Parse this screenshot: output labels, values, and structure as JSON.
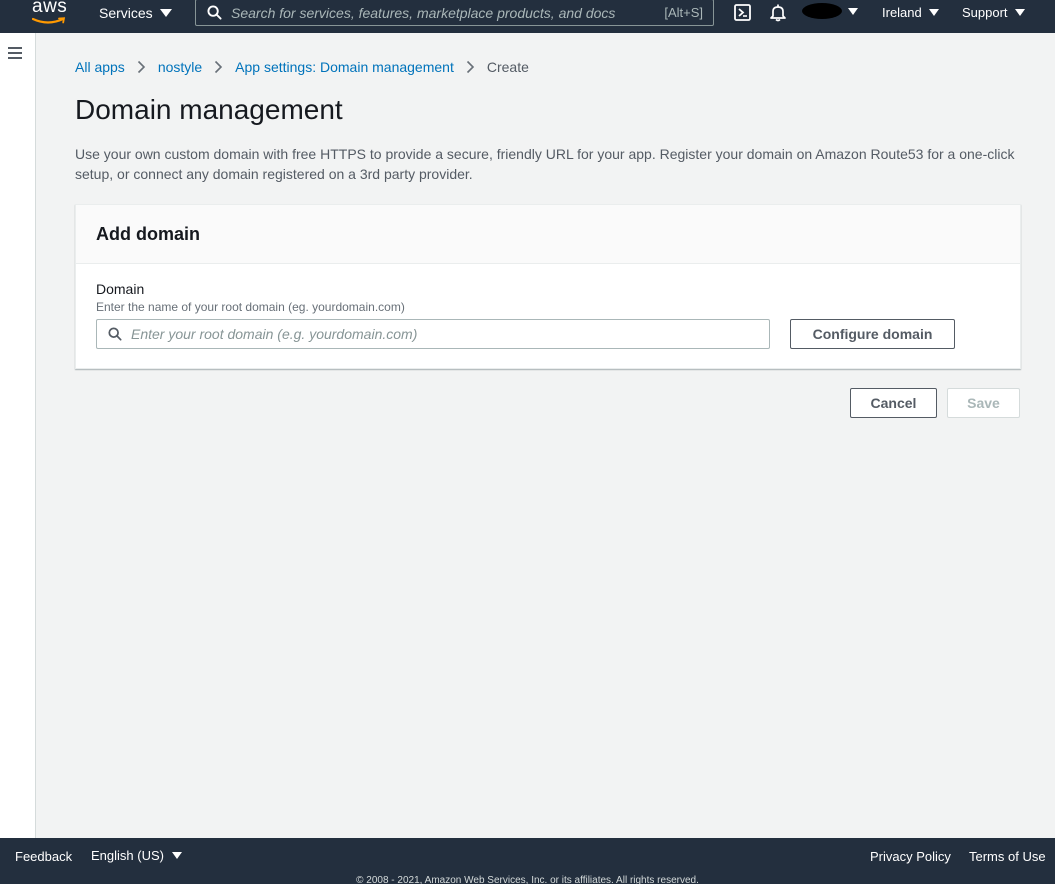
{
  "topnav": {
    "logo_text": "aws",
    "services_label": "Services",
    "search_placeholder": "Search for services, features, marketplace products, and docs",
    "search_shortcut": "[Alt+S]",
    "region_label": "Ireland",
    "support_label": "Support"
  },
  "breadcrumb": [
    {
      "label": "All apps"
    },
    {
      "label": "nostyle"
    },
    {
      "label": "App settings: Domain management"
    },
    {
      "label": "Create"
    }
  ],
  "page": {
    "title": "Domain management",
    "description": "Use your own custom domain with free HTTPS to provide a secure, friendly URL for your app. Register your domain on Amazon Route53 for a one-click setup, or connect any domain registered on a 3rd party provider."
  },
  "panel": {
    "title": "Add domain",
    "field_label": "Domain",
    "field_description": "Enter the name of your root domain (eg. yourdomain.com)",
    "input_value": "",
    "input_placeholder": "Enter your root domain (e.g. yourdomain.com)",
    "configure_label": "Configure domain"
  },
  "actions": {
    "cancel_label": "Cancel",
    "save_label": "Save"
  },
  "footer": {
    "feedback_label": "Feedback",
    "language_label": "English (US)",
    "privacy_label": "Privacy Policy",
    "terms_label": "Terms of Use",
    "copyright": "© 2008 - 2021, Amazon Web Services, Inc. or its affiliates. All rights reserved."
  },
  "colors": {
    "nav_bg": "#232f3e",
    "link": "#0073bb",
    "page_bg": "#f2f3f3",
    "smile": "#ff9900"
  },
  "icons": [
    "search-icon",
    "cloudshell-icon",
    "bell-icon",
    "hamburger-icon",
    "chevron-right-icon",
    "caret-down-icon"
  ]
}
